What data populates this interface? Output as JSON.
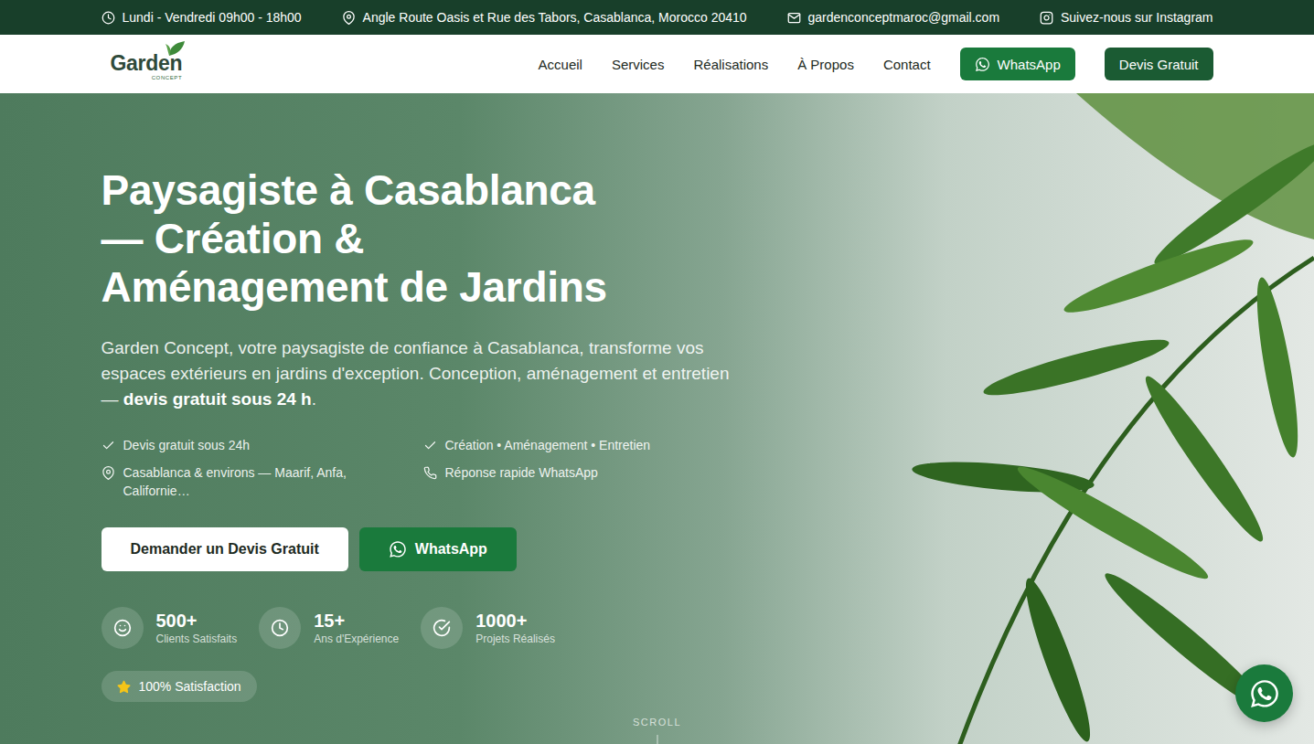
{
  "topbar": [
    {
      "kind": "hours",
      "text": "Lundi - Vendredi 09h00 - 18h00"
    },
    {
      "kind": "address",
      "text": "Angle Route Oasis et Rue des Tabors, Casablanca, Morocco 20410"
    },
    {
      "kind": "email",
      "text": "gardenconceptmaroc@gmail.com"
    },
    {
      "kind": "instagram",
      "text": "Suivez-nous sur Instagram"
    }
  ],
  "logo": {
    "name": "Garden",
    "tagline": "CONCEPT"
  },
  "nav": {
    "links": [
      "Accueil",
      "Services",
      "Réalisations",
      "À Propos",
      "Contact"
    ],
    "whatsapp": "WhatsApp",
    "quote": "Devis Gratuit"
  },
  "hero": {
    "title_lines": [
      "Paysagiste à Casablanca",
      "— Création &",
      "Aménagement de Jardins"
    ],
    "subtitle": {
      "text": "Garden Concept, votre paysagiste de confiance à Casablanca, transforme vos espaces extérieurs en jardins d'exception. Conception, aménagement et entretien — ",
      "bold": "devis gratuit sous 24 h",
      "end": "."
    },
    "features": [
      {
        "kind": "check",
        "text": "Devis gratuit sous 24h"
      },
      {
        "kind": "check",
        "text": "Création • Aménagement • Entretien"
      },
      {
        "kind": "pin",
        "text": "Casablanca & environs — Maarif, Anfa, Californie…"
      },
      {
        "kind": "phone",
        "text": "Réponse rapide WhatsApp"
      }
    ],
    "buttons": {
      "primary": "Demander un Devis Gratuit",
      "whatsapp": "WhatsApp"
    },
    "stats": [
      {
        "kind": "smile",
        "value": "500+",
        "label": "Clients Satisfaits"
      },
      {
        "kind": "clock",
        "value": "15+",
        "label": "Ans d'Expérience"
      },
      {
        "kind": "check",
        "value": "1000+",
        "label": "Projets Réalisés"
      }
    ],
    "badge": "100% Satisfaction",
    "scroll": "SCROLL"
  }
}
